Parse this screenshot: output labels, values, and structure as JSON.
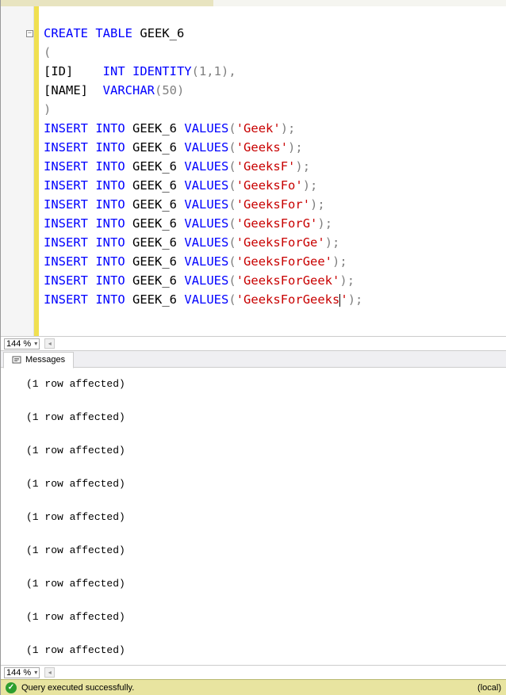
{
  "code": {
    "tableName": "GEEK_6",
    "columns": {
      "id": "[ID]",
      "idType": "INT IDENTITY",
      "idArgs": "(1,1)",
      "name": "[NAME]",
      "nameType": "VARCHAR",
      "nameArgs": "(50)"
    },
    "keywords": {
      "create": "CREATE",
      "table": "TABLE",
      "insert": "INSERT",
      "into": "INTO",
      "values": "VALUES"
    },
    "inserts": [
      "Geek",
      "Geeks",
      "GeeksF",
      "GeeksFo",
      "GeeksFor",
      "GeeksForG",
      "GeeksForGe",
      "GeeksForGee",
      "GeeksForGeek",
      "GeeksForGeeks"
    ]
  },
  "zoom1": "144 %",
  "zoom2": "144 %",
  "tab": {
    "label": "Messages"
  },
  "messages": {
    "rowAffected": "(1 row affected)",
    "count": 9
  },
  "status": {
    "text": "Query executed successfully.",
    "right": "(local)"
  }
}
